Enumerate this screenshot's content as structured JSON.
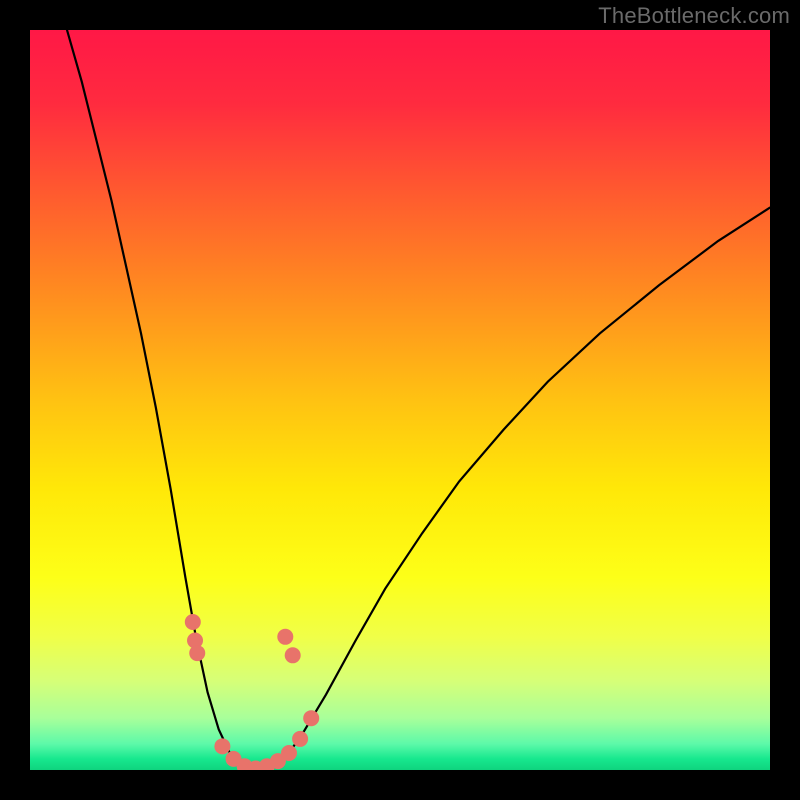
{
  "watermark": "TheBottleneck.com",
  "chart_data": {
    "type": "line",
    "title": "",
    "xlabel": "",
    "ylabel": "",
    "xlim": [
      0,
      100
    ],
    "ylim": [
      0,
      100
    ],
    "grid": false,
    "gradient_stops": [
      {
        "offset": 0.0,
        "color": "#ff1846"
      },
      {
        "offset": 0.1,
        "color": "#ff2b3f"
      },
      {
        "offset": 0.22,
        "color": "#ff5a2f"
      },
      {
        "offset": 0.35,
        "color": "#ff8a20"
      },
      {
        "offset": 0.5,
        "color": "#ffc212"
      },
      {
        "offset": 0.62,
        "color": "#ffe808"
      },
      {
        "offset": 0.74,
        "color": "#fdff18"
      },
      {
        "offset": 0.82,
        "color": "#f0ff48"
      },
      {
        "offset": 0.88,
        "color": "#d6ff78"
      },
      {
        "offset": 0.93,
        "color": "#a8ff9a"
      },
      {
        "offset": 0.965,
        "color": "#5cf9a9"
      },
      {
        "offset": 0.985,
        "color": "#17e88e"
      },
      {
        "offset": 1.0,
        "color": "#0fd37e"
      }
    ],
    "series": [
      {
        "name": "bottleneck-curve",
        "color": "#000000",
        "x": [
          5,
          7,
          9,
          11,
          13,
          15,
          17,
          19,
          21,
          22.5,
          24,
          25.5,
          27,
          28.5,
          29.5,
          30.5,
          31.5,
          33,
          35,
          37,
          40,
          44,
          48,
          53,
          58,
          64,
          70,
          77,
          85,
          93,
          100
        ],
        "y": [
          100,
          93,
          85,
          77,
          68,
          59,
          49,
          38,
          26,
          17.5,
          10.5,
          5.5,
          2.3,
          0.7,
          0.25,
          0.2,
          0.25,
          0.7,
          2.3,
          5.2,
          10.2,
          17.5,
          24.5,
          32,
          39,
          46,
          52.5,
          59,
          65.5,
          71.5,
          76
        ]
      }
    ],
    "markers": {
      "name": "dip-points",
      "color": "#e8736a",
      "points": [
        {
          "x": 22.0,
          "y": 20.0
        },
        {
          "x": 22.3,
          "y": 17.5
        },
        {
          "x": 22.6,
          "y": 15.8
        },
        {
          "x": 26.0,
          "y": 3.2
        },
        {
          "x": 27.5,
          "y": 1.5
        },
        {
          "x": 29.0,
          "y": 0.5
        },
        {
          "x": 30.5,
          "y": 0.2
        },
        {
          "x": 32.0,
          "y": 0.5
        },
        {
          "x": 33.5,
          "y": 1.2
        },
        {
          "x": 35.0,
          "y": 2.3
        },
        {
          "x": 36.5,
          "y": 4.2
        },
        {
          "x": 38.0,
          "y": 7.0
        },
        {
          "x": 34.5,
          "y": 18.0
        },
        {
          "x": 35.5,
          "y": 15.5
        }
      ]
    }
  }
}
